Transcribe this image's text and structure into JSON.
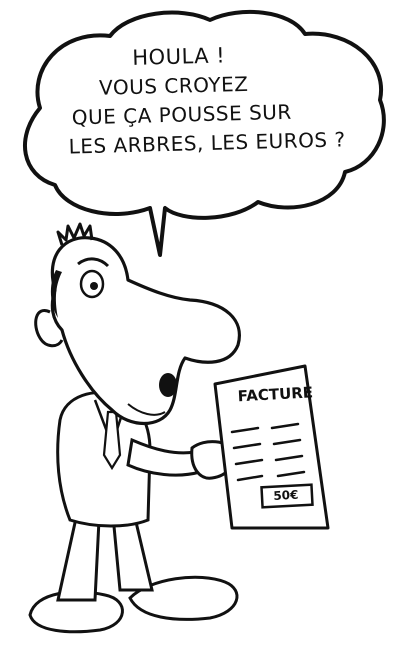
{
  "speech_bubble": {
    "lines": [
      "HOULA !",
      "VOUS CROYEZ",
      "QUE ÇA POUSSE SUR",
      "LES ARBRES, LES EUROS ?"
    ]
  },
  "invoice": {
    "title": "FACTURE",
    "amount": "50€"
  }
}
